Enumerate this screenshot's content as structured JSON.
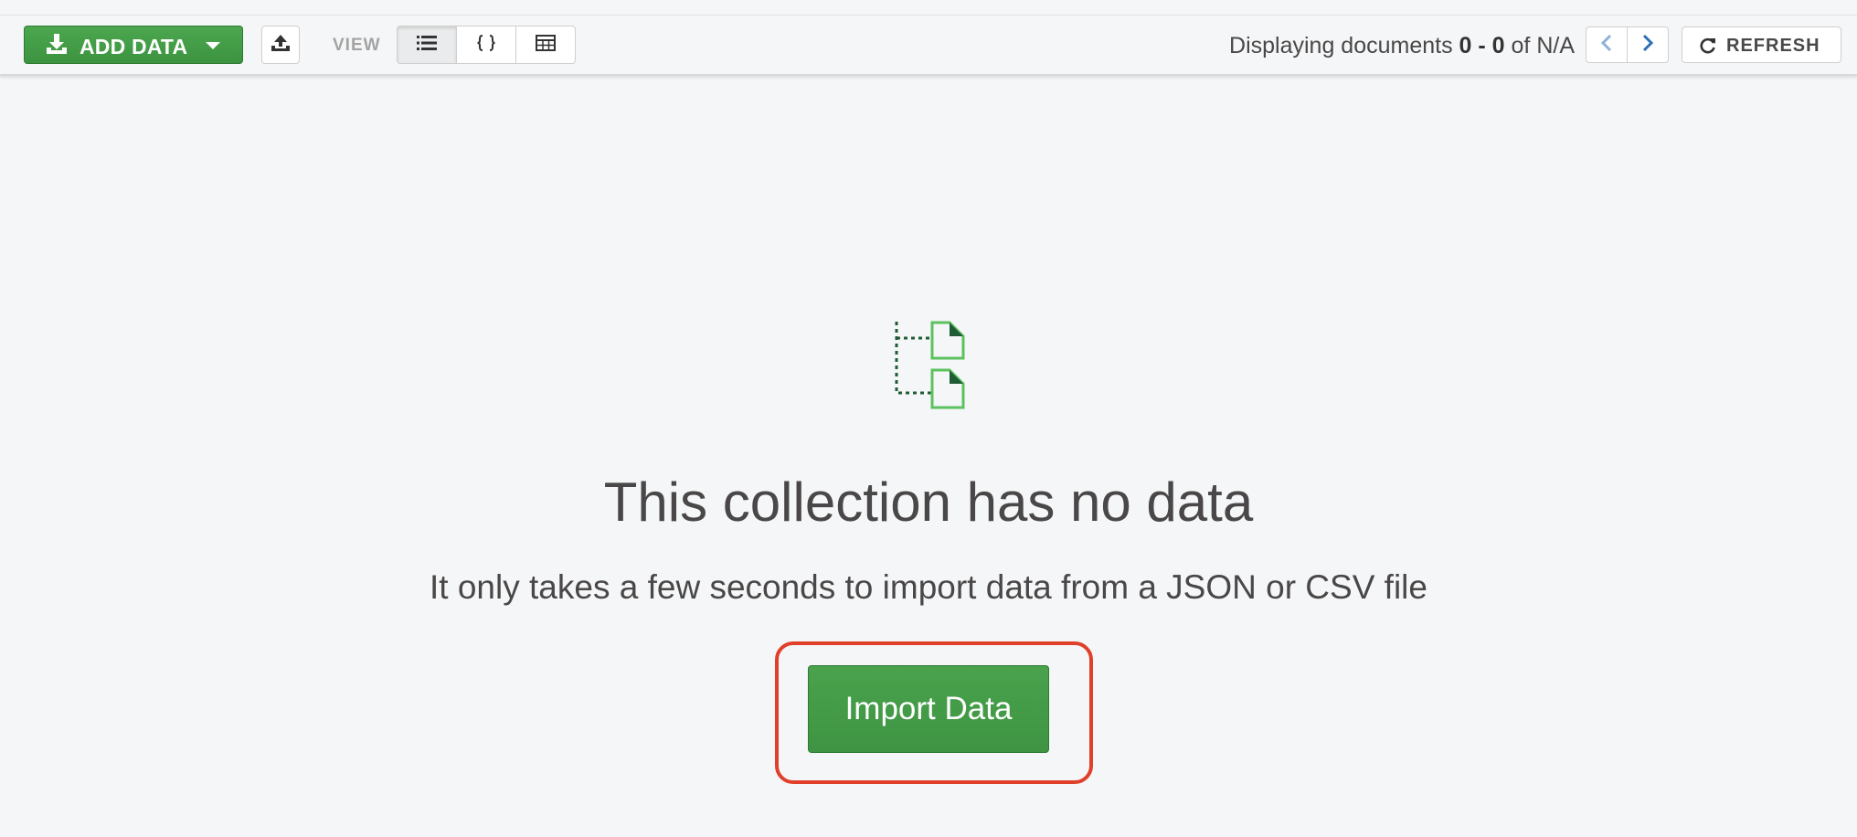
{
  "toolbar": {
    "add_data_label": "ADD DATA",
    "view_label": "VIEW",
    "view_modes": [
      "list",
      "json",
      "table"
    ],
    "active_view": "list",
    "doc_count": {
      "prefix": "Displaying documents ",
      "range": "0 - 0",
      "middle": " of ",
      "total": "N/A"
    },
    "refresh_label": "REFRESH"
  },
  "empty_state": {
    "title": "This collection has no data",
    "subtitle": "It only takes a few seconds to import data from a JSON or CSV file",
    "import_button_label": "Import Data"
  },
  "colors": {
    "accent_green": "#3e9442",
    "highlight_red": "#e0402a",
    "pager_blue": "#2c6fb7",
    "icon_green": "#5cc260",
    "icon_dark_green": "#1f5c36"
  },
  "icons": {
    "add_data": "download-icon",
    "upload": "upload-icon",
    "list_view": "list-icon",
    "json_view": "braces-icon",
    "table_view": "table-icon",
    "prev": "chevron-left-icon",
    "next": "chevron-right-icon",
    "refresh": "refresh-icon",
    "empty": "document-tree-icon"
  }
}
